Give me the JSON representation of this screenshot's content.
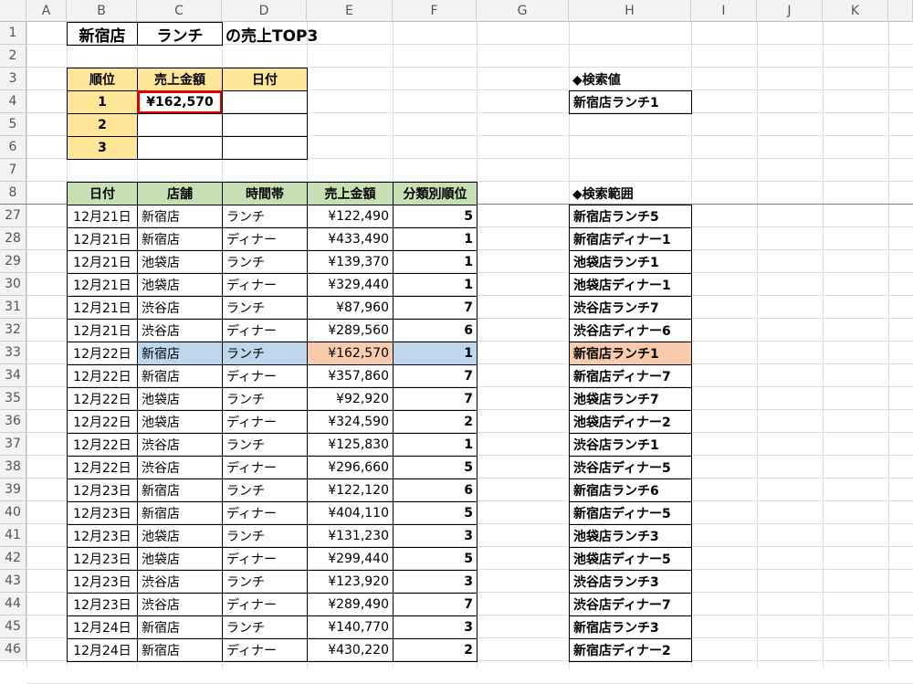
{
  "columns": [
    "A",
    "B",
    "C",
    "D",
    "E",
    "F",
    "G",
    "H",
    "I",
    "J",
    "K"
  ],
  "title": {
    "store": "新宿店",
    "period": "ランチ",
    "suffix": "の売上TOP3"
  },
  "top_table": {
    "headers": [
      "順位",
      "売上金額",
      "日付"
    ],
    "rows": [
      {
        "rank": "1",
        "amount": "¥162,570",
        "date": ""
      },
      {
        "rank": "2",
        "amount": "",
        "date": ""
      },
      {
        "rank": "3",
        "amount": "",
        "date": ""
      }
    ]
  },
  "search_value": {
    "label": "◆検索値",
    "value": "新宿店ランチ1"
  },
  "search_range_label": "◆検索範囲",
  "data_table": {
    "headers": [
      "日付",
      "店舗",
      "時間帯",
      "売上金額",
      "分類別順位"
    ],
    "row_numbers": [
      "27",
      "28",
      "29",
      "30",
      "31",
      "32",
      "33",
      "34",
      "35",
      "36",
      "37",
      "38",
      "39",
      "40",
      "41",
      "42",
      "43",
      "44",
      "45",
      "46"
    ],
    "rows": [
      {
        "date": "12月21日",
        "store": "新宿店",
        "time": "ランチ",
        "amount": "¥122,490",
        "rank": "5",
        "key": "新宿店ランチ5"
      },
      {
        "date": "12月21日",
        "store": "新宿店",
        "time": "ディナー",
        "amount": "¥433,490",
        "rank": "1",
        "key": "新宿店ディナー1"
      },
      {
        "date": "12月21日",
        "store": "池袋店",
        "time": "ランチ",
        "amount": "¥139,370",
        "rank": "1",
        "key": "池袋店ランチ1"
      },
      {
        "date": "12月21日",
        "store": "池袋店",
        "time": "ディナー",
        "amount": "¥329,440",
        "rank": "1",
        "key": "池袋店ディナー1"
      },
      {
        "date": "12月21日",
        "store": "渋谷店",
        "time": "ランチ",
        "amount": "¥87,960",
        "rank": "7",
        "key": "渋谷店ランチ7"
      },
      {
        "date": "12月21日",
        "store": "渋谷店",
        "time": "ディナー",
        "amount": "¥289,560",
        "rank": "6",
        "key": "渋谷店ディナー6"
      },
      {
        "date": "12月22日",
        "store": "新宿店",
        "time": "ランチ",
        "amount": "¥162,570",
        "rank": "1",
        "key": "新宿店ランチ1"
      },
      {
        "date": "12月22日",
        "store": "新宿店",
        "time": "ディナー",
        "amount": "¥357,860",
        "rank": "7",
        "key": "新宿店ディナー7"
      },
      {
        "date": "12月22日",
        "store": "池袋店",
        "time": "ランチ",
        "amount": "¥92,920",
        "rank": "7",
        "key": "池袋店ランチ7"
      },
      {
        "date": "12月22日",
        "store": "池袋店",
        "time": "ディナー",
        "amount": "¥324,590",
        "rank": "2",
        "key": "池袋店ディナー2"
      },
      {
        "date": "12月22日",
        "store": "渋谷店",
        "time": "ランチ",
        "amount": "¥125,830",
        "rank": "1",
        "key": "渋谷店ランチ1"
      },
      {
        "date": "12月22日",
        "store": "渋谷店",
        "time": "ディナー",
        "amount": "¥296,660",
        "rank": "5",
        "key": "渋谷店ディナー5"
      },
      {
        "date": "12月23日",
        "store": "新宿店",
        "time": "ランチ",
        "amount": "¥122,120",
        "rank": "6",
        "key": "新宿店ランチ6"
      },
      {
        "date": "12月23日",
        "store": "新宿店",
        "time": "ディナー",
        "amount": "¥404,110",
        "rank": "5",
        "key": "新宿店ディナー5"
      },
      {
        "date": "12月23日",
        "store": "池袋店",
        "time": "ランチ",
        "amount": "¥131,230",
        "rank": "3",
        "key": "池袋店ランチ3"
      },
      {
        "date": "12月23日",
        "store": "池袋店",
        "time": "ディナー",
        "amount": "¥299,440",
        "rank": "5",
        "key": "池袋店ディナー5"
      },
      {
        "date": "12月23日",
        "store": "渋谷店",
        "time": "ランチ",
        "amount": "¥123,920",
        "rank": "3",
        "key": "渋谷店ランチ3"
      },
      {
        "date": "12月23日",
        "store": "渋谷店",
        "time": "ディナー",
        "amount": "¥289,490",
        "rank": "7",
        "key": "渋谷店ディナー7"
      },
      {
        "date": "12月24日",
        "store": "新宿店",
        "time": "ランチ",
        "amount": "¥140,770",
        "rank": "3",
        "key": "新宿店ランチ3"
      },
      {
        "date": "12月24日",
        "store": "新宿店",
        "time": "ディナー",
        "amount": "¥430,220",
        "rank": "2",
        "key": "新宿店ディナー2"
      }
    ]
  },
  "highlight_row_index": 6,
  "colors": {
    "header_yellow": "#ffe699",
    "header_green": "#c6e0b4",
    "match_blue": "#bdd7ee",
    "match_peach": "#f8cbad",
    "selection_red": "#e00000"
  }
}
